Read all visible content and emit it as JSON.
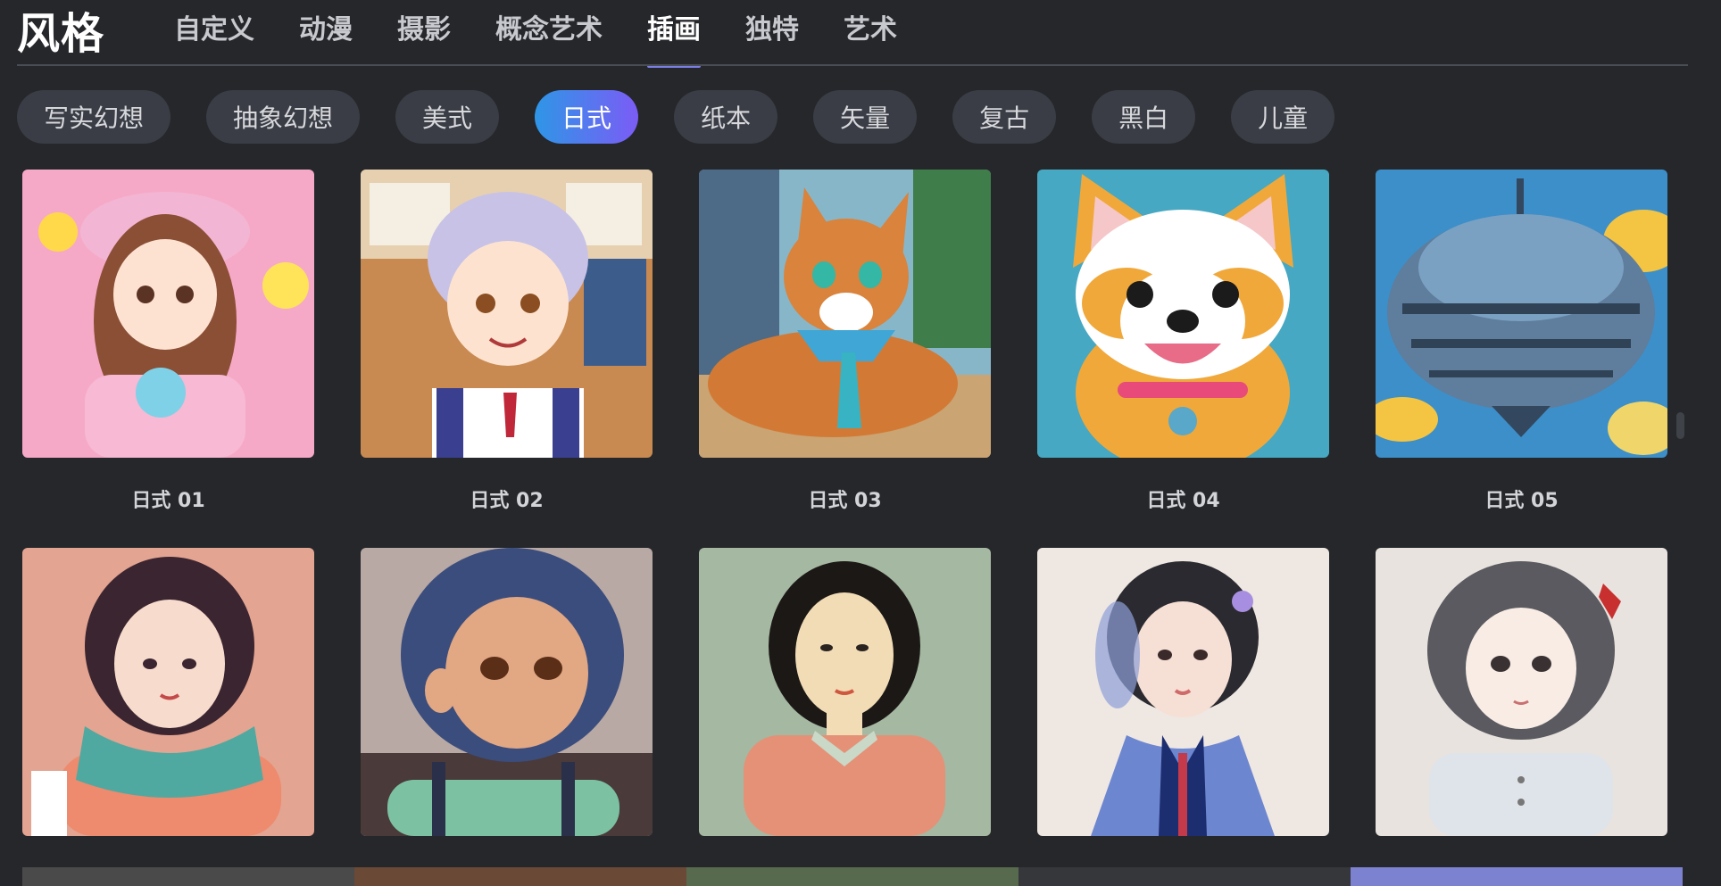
{
  "header": {
    "title": "风格",
    "tabs": [
      "自定义",
      "动漫",
      "摄影",
      "概念艺术",
      "插画",
      "独特",
      "艺术"
    ],
    "active_tab": "插画"
  },
  "filters": {
    "chips": [
      "写实幻想",
      "抽象幻想",
      "美式",
      "日式",
      "纸本",
      "矢量",
      "复古",
      "黑白",
      "儿童"
    ],
    "active_chip": "日式"
  },
  "styles_grid": {
    "row1": [
      {
        "label": "日式 01",
        "icon": "anime-girl-pink-hat-thumbnail"
      },
      {
        "label": "日式 02",
        "icon": "anime-boy-silver-hair-thumbnail"
      },
      {
        "label": "日式 03",
        "icon": "anime-cat-tie-thumbnail"
      },
      {
        "label": "日式 04",
        "icon": "shiba-dog-cartoon-thumbnail"
      },
      {
        "label": "日式 05",
        "icon": "steampunk-airship-thumbnail"
      }
    ],
    "row2": [
      {
        "icon": "girl-teal-scarf-thumbnail"
      },
      {
        "icon": "girl-navy-hair-thumbnail"
      },
      {
        "icon": "woman-flat-portrait-thumbnail"
      },
      {
        "icon": "girl-kimono-watercolor-thumbnail"
      },
      {
        "icon": "girl-pencil-sketch-thumbnail"
      }
    ]
  },
  "colors": {
    "background": "#25272b",
    "chip_bg": "#3a3d45",
    "active_chip_start": "#2e96e6",
    "active_chip_end": "#7b5cf6",
    "tab_underline": "#7a7ee6"
  }
}
